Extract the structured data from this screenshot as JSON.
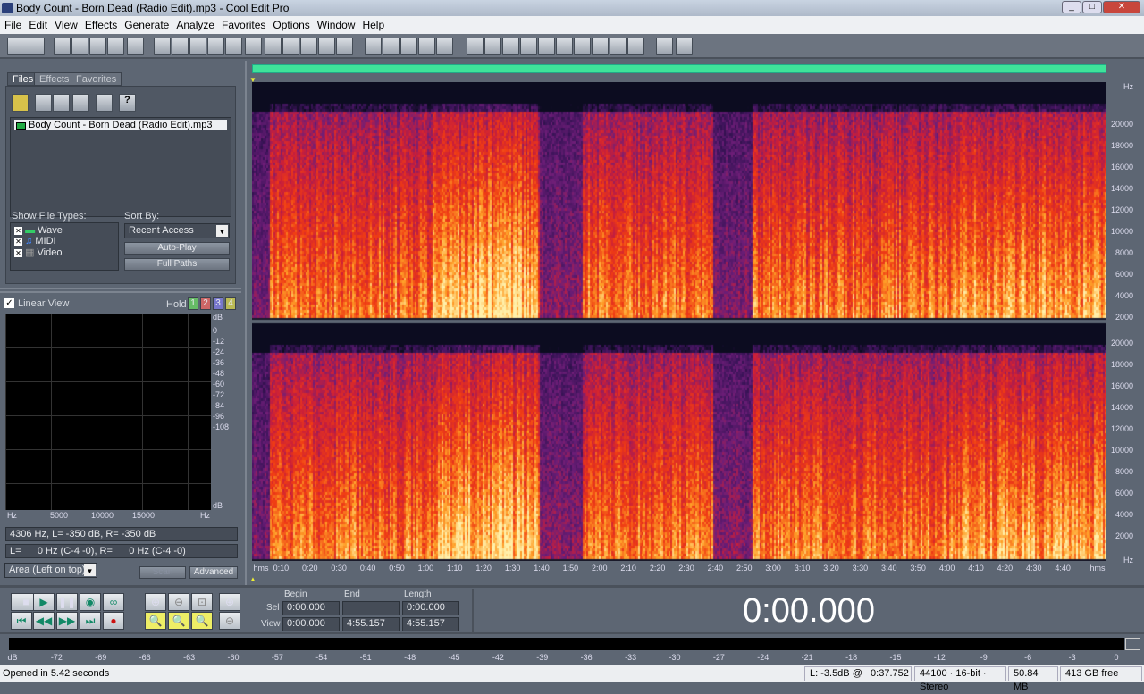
{
  "window": {
    "title": "Body Count - Born Dead (Radio Edit).mp3 - Cool Edit Pro",
    "controls": [
      "_",
      "□",
      "✕"
    ]
  },
  "menu": [
    "File",
    "Edit",
    "View",
    "Effects",
    "Generate",
    "Analyze",
    "Favorites",
    "Options",
    "Window",
    "Help"
  ],
  "organizer": {
    "tabs": [
      "Files",
      "Effects",
      "Favorites"
    ],
    "files": [
      "Body Count - Born Dead (Radio Edit).mp3"
    ],
    "show_file_types_label": "Show File Types:",
    "file_types": [
      {
        "label": "Wave",
        "checked": true
      },
      {
        "label": "MIDI",
        "checked": true
      },
      {
        "label": "Video",
        "checked": true
      }
    ],
    "sort_by_label": "Sort By:",
    "sort_by": "Recent Access",
    "auto_play": "Auto-Play",
    "full_paths": "Full Paths"
  },
  "analysis": {
    "linear_view": "Linear View",
    "linear_checked": true,
    "hold": "Hold",
    "hold_buttons": [
      "1",
      "2",
      "3",
      "4"
    ],
    "db_ticks": [
      "dB",
      "0",
      "-12",
      "-24",
      "-36",
      "-48",
      "-60",
      "-72",
      "-84",
      "-96",
      "-108",
      "dB"
    ],
    "hz_ticks": [
      "Hz",
      "5000",
      "10000",
      "15000",
      "Hz"
    ],
    "readout1": "4306 Hz, L=  -350 dB, R=  -350 dB",
    "readout2": "L=      0 Hz (C-4 -0), R=      0 Hz (C-4 -0)",
    "view_mode": "Area (Left on top)",
    "scan": "Scan",
    "advanced": "Advanced"
  },
  "spectrogram": {
    "freq_ticks": [
      "Hz",
      "20000",
      "18000",
      "16000",
      "14000",
      "12000",
      "10000",
      "8000",
      "6000",
      "4000",
      "2000"
    ],
    "freq_ticks_bottom": [
      "20000",
      "18000",
      "16000",
      "14000",
      "12000",
      "10000",
      "8000",
      "6000",
      "4000",
      "2000",
      "Hz"
    ],
    "time_ticks": [
      "hms",
      "0:10",
      "0:20",
      "0:30",
      "0:40",
      "0:50",
      "1:00",
      "1:10",
      "1:20",
      "1:30",
      "1:40",
      "1:50",
      "2:00",
      "2:10",
      "2:20",
      "2:30",
      "2:40",
      "2:50",
      "3:00",
      "3:10",
      "3:20",
      "3:30",
      "3:40",
      "3:50",
      "4:00",
      "4:10",
      "4:20",
      "4:30",
      "4:40",
      "hms"
    ]
  },
  "transport": {
    "begin": "Begin",
    "end": "End",
    "length": "Length",
    "sel": "Sel",
    "view": "View",
    "sel_begin": "0:00.000",
    "sel_end": "",
    "sel_length": "0:00.000",
    "view_begin": "0:00.000",
    "view_end": "4:55.157",
    "view_length": "4:55.157",
    "time_display": "0:00.000"
  },
  "meter": {
    "ticks": [
      "dB",
      "-72",
      "-69",
      "-66",
      "-63",
      "-60",
      "-57",
      "-54",
      "-51",
      "-48",
      "-45",
      "-42",
      "-39",
      "-36",
      "-33",
      "-30",
      "-27",
      "-24",
      "-21",
      "-18",
      "-15",
      "-12",
      "-9",
      "-6",
      "-3",
      "0"
    ]
  },
  "status": {
    "message": "Opened in 5.42 seconds",
    "level": "L: -3.5dB @   0:37.752",
    "format": "44100 · 16-bit · Stereo",
    "size": "50.84 MB",
    "free": "413 GB free"
  },
  "colors": {
    "accent_bar": "#3fe39a",
    "background": "#5d6673"
  }
}
